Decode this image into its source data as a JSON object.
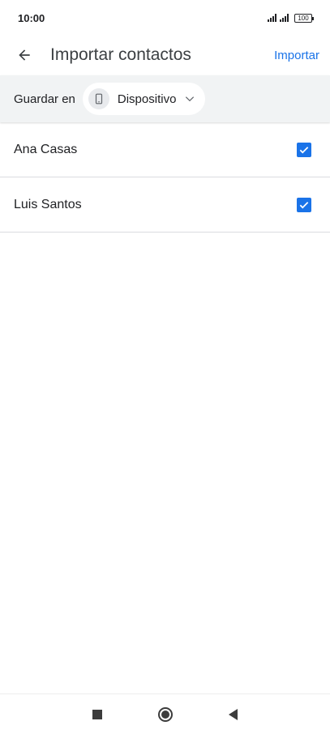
{
  "status_bar": {
    "time": "10:00",
    "battery": "100"
  },
  "app_bar": {
    "back_icon": "arrow-back-icon",
    "title": "Importar contactos",
    "action_label": "Importar"
  },
  "save_to": {
    "label": "Guardar en",
    "chip_icon": "phone-icon",
    "chip_label": "Dispositivo",
    "chip_dropdown_icon": "chevron-down-icon"
  },
  "contacts": [
    {
      "name": "Ana Casas",
      "checked": true
    },
    {
      "name": "Luis Santos",
      "checked": true
    }
  ],
  "nav_bar": {
    "recents_icon": "square-recents-icon",
    "home_icon": "circle-home-icon",
    "back_icon": "triangle-back-icon"
  },
  "colors": {
    "accent": "#1a73e8",
    "save_bar_bg": "#f1f3f4",
    "divider": "#dadce0"
  }
}
